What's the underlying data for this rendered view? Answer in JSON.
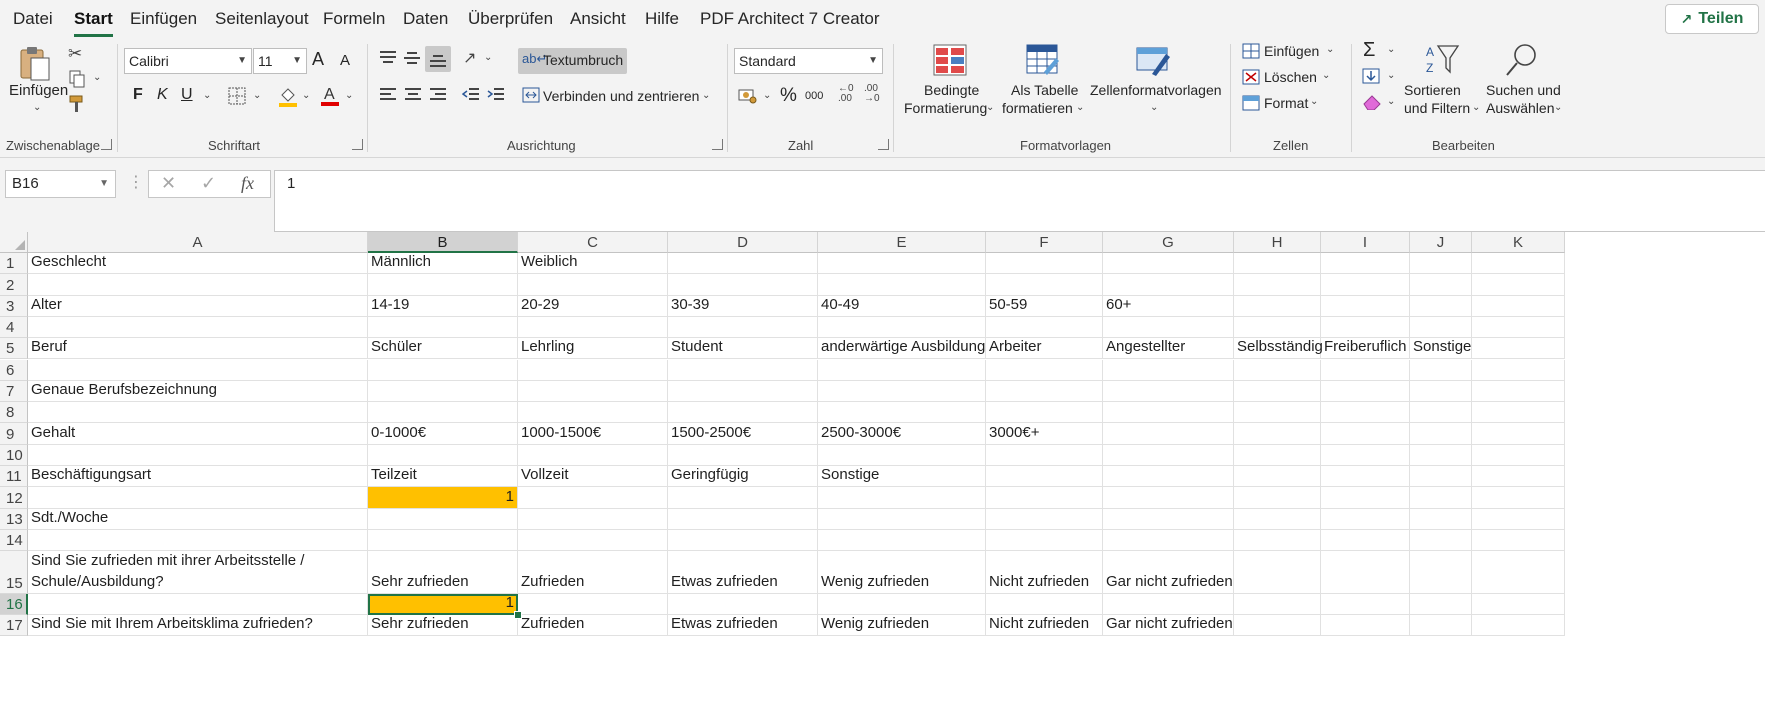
{
  "menu": {
    "tabs": [
      "Datei",
      "Start",
      "Einfügen",
      "Seitenlayout",
      "Formeln",
      "Daten",
      "Überprüfen",
      "Ansicht",
      "Hilfe",
      "PDF Architect 7 Creator"
    ],
    "active_tab": "Start",
    "share_label": "Teilen"
  },
  "ribbon": {
    "clipboard": {
      "paste_label": "Einfügen",
      "group_label": "Zwischenablage"
    },
    "font": {
      "font_name": "Calibri",
      "font_size": "11",
      "bold": "F",
      "italic": "K",
      "underline": "U",
      "group_label": "Schriftart",
      "grow_label": "A",
      "shrink_label": "A"
    },
    "alignment": {
      "wrap_text": "Textumbruch",
      "merge_center": "Verbinden und zentrieren",
      "group_label": "Ausrichtung"
    },
    "number": {
      "format": "Standard",
      "percent": "%",
      "thousands": "000",
      "group_label": "Zahl"
    },
    "styles": {
      "conditional_line1": "Bedingte",
      "conditional_line2": "Formatierung",
      "as_table_line1": "Als Tabelle",
      "as_table_line2": "formatieren",
      "cell_styles": "Zellenformatvorlagen",
      "group_label": "Formatvorlagen"
    },
    "cells": {
      "insert": "Einfügen",
      "delete": "Löschen",
      "format": "Format",
      "group_label": "Zellen"
    },
    "editing": {
      "sort_line1": "Sortieren",
      "sort_line2": "und Filtern",
      "find_line1": "Suchen und",
      "find_line2": "Auswählen",
      "group_label": "Bearbeiten",
      "sum_symbol": "Σ"
    }
  },
  "formula_bar": {
    "name_box": "B16",
    "fx_label": "fx",
    "value": "1"
  },
  "sheet": {
    "columns": [
      "A",
      "B",
      "C",
      "D",
      "E",
      "F",
      "G",
      "H",
      "I",
      "J",
      "K"
    ],
    "selected_column": "B",
    "selected_row": "16",
    "rows": [
      {
        "n": "1",
        "cells": [
          "Geschlecht",
          "Männlich",
          "Weiblich",
          "",
          "",
          "",
          "",
          "",
          "",
          "",
          ""
        ]
      },
      {
        "n": "2",
        "cells": [
          "",
          "",
          "",
          "",
          "",
          "",
          "",
          "",
          "",
          "",
          ""
        ]
      },
      {
        "n": "3",
        "cells": [
          "Alter",
          "14-19",
          "20-29",
          "30-39",
          "40-49",
          "50-59",
          "60+",
          "",
          "",
          "",
          ""
        ]
      },
      {
        "n": "4",
        "cells": [
          "",
          "",
          "",
          "",
          "",
          "",
          "",
          "",
          "",
          "",
          ""
        ]
      },
      {
        "n": "5",
        "cells": [
          "Beruf",
          "Schüler",
          "Lehrling",
          "Student",
          "anderwärtige Ausbildung",
          "Arbeiter",
          "Angestellter",
          "Selbsständig",
          "Freiberuflich",
          "Sonstige",
          ""
        ]
      },
      {
        "n": "6",
        "cells": [
          "",
          "",
          "",
          "",
          "",
          "",
          "",
          "",
          "",
          "",
          ""
        ]
      },
      {
        "n": "7",
        "cells": [
          "Genaue Berufsbezeichnung",
          "",
          "",
          "",
          "",
          "",
          "",
          "",
          "",
          "",
          ""
        ]
      },
      {
        "n": "8",
        "cells": [
          "",
          "",
          "",
          "",
          "",
          "",
          "",
          "",
          "",
          "",
          ""
        ]
      },
      {
        "n": "9",
        "cells": [
          "Gehalt",
          "0-1000€",
          "1000-1500€",
          "1500-2500€",
          "2500-3000€",
          "3000€+",
          "",
          "",
          "",
          "",
          ""
        ]
      },
      {
        "n": "10",
        "cells": [
          "",
          "",
          "",
          "",
          "",
          "",
          "",
          "",
          "",
          "",
          ""
        ]
      },
      {
        "n": "11",
        "cells": [
          "Beschäftigungsart",
          "Teilzeit",
          "Vollzeit",
          "Geringfügig",
          "Sonstige",
          "",
          "",
          "",
          "",
          "",
          ""
        ]
      },
      {
        "n": "12",
        "cells": [
          "",
          "1",
          "",
          "",
          "",
          "",
          "",
          "",
          "",
          "",
          ""
        ]
      },
      {
        "n": "13",
        "cells": [
          "Sdt./Woche",
          "",
          "",
          "",
          "",
          "",
          "",
          "",
          "",
          "",
          ""
        ]
      },
      {
        "n": "14",
        "cells": [
          "",
          "",
          "",
          "",
          "",
          "",
          "",
          "",
          "",
          "",
          ""
        ]
      },
      {
        "n": "15",
        "cells": [
          "Sind Sie zufrieden mit ihrer Arbeitsstelle / Schule/Ausbildung?",
          "Sehr zufrieden",
          "Zufrieden",
          "Etwas zufrieden",
          "Wenig zufrieden",
          "Nicht zufrieden",
          "Gar nicht zufrieden",
          "",
          "",
          "",
          ""
        ]
      },
      {
        "n": "16",
        "cells": [
          "",
          "1",
          "",
          "",
          "",
          "",
          "",
          "",
          "",
          "",
          ""
        ]
      },
      {
        "n": "17",
        "cells": [
          "Sind Sie mit Ihrem Arbeitsklima zufrieden?",
          "Sehr zufrieden",
          "Zufrieden",
          "Etwas zufrieden",
          "Wenig zufrieden",
          "Nicht zufrieden",
          "Gar nicht zufrieden",
          "",
          "",
          "",
          ""
        ]
      }
    ],
    "fill_color": "#ffc000",
    "accent_color": "#217346"
  }
}
